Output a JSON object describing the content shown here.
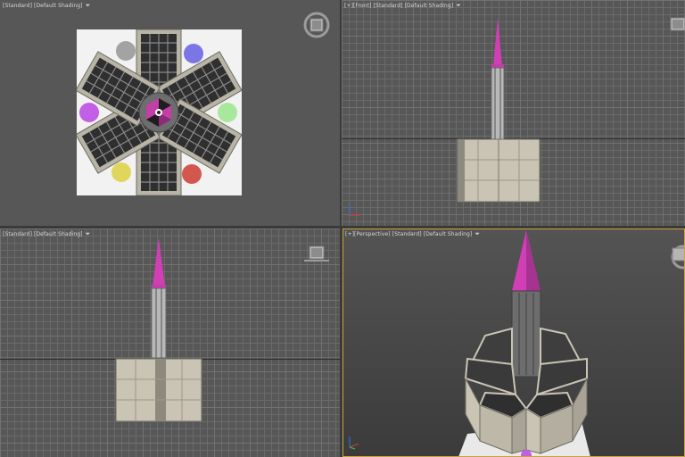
{
  "viewports": {
    "top_left": {
      "label_prefix": "[",
      "label_view": "Standard",
      "label_mid": "] [",
      "label_shading": "Default Shading",
      "label_suffix": "]"
    },
    "top_right": {
      "label_plus": "[+]",
      "label_view": "[Front]",
      "label_std": "[Standard]",
      "label_shading": "[Default Shading]"
    },
    "bottom_left": {
      "label_prefix": "[",
      "label_view": "Standard",
      "label_mid": "] [",
      "label_shading": "Default Shading",
      "label_suffix": "]"
    },
    "bottom_right": {
      "label_plus": "[+]",
      "label_view": "[Perspective]",
      "label_std": "[Standard]",
      "label_shading": "[Default Shading]"
    }
  },
  "filter_icon": "funnel-icon",
  "colors": {
    "viewport_bg": "#575757",
    "active_border": "#c9a43b",
    "spire_pink": "#d13fb5",
    "stone": "#c9c4b3",
    "tile_dark": "#2f2f2f",
    "circle_gray": "#a3a3a3",
    "circle_blue": "#7a76e6",
    "circle_green": "#a8e89c",
    "circle_purple": "#c35ee6",
    "circle_yellow": "#e0d65c",
    "circle_red": "#d2574e"
  }
}
